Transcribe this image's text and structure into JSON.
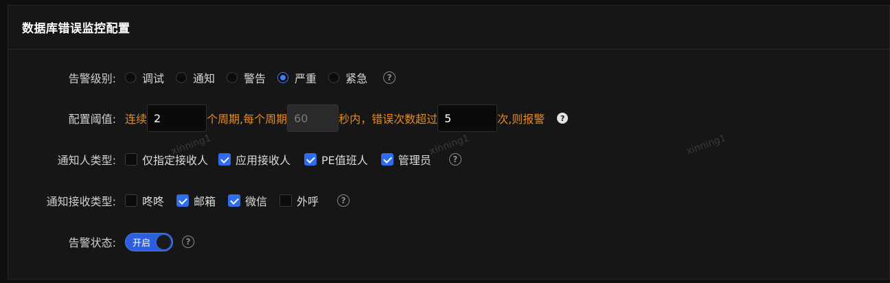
{
  "panel": {
    "title": "数据库错误监控配置"
  },
  "alert_level": {
    "label": "告警级别:",
    "options": [
      {
        "label": "调试",
        "checked": false
      },
      {
        "label": "通知",
        "checked": false
      },
      {
        "label": "警告",
        "checked": false
      },
      {
        "label": "严重",
        "checked": true
      },
      {
        "label": "紧急",
        "checked": false
      }
    ]
  },
  "threshold": {
    "label": "配置阈值:",
    "text_before_periods": "连续",
    "periods_value": "2",
    "text_after_periods": "个周期,每个周期",
    "period_seconds_placeholder": "60",
    "text_after_seconds": "秒内，错误次数超过",
    "error_count_value": "5",
    "text_after_count": "次,则报警"
  },
  "notify_person_types": {
    "label": "通知人类型:",
    "options": [
      {
        "label": "仅指定接收人",
        "checked": false
      },
      {
        "label": "应用接收人",
        "checked": true
      },
      {
        "label": "PE值班人",
        "checked": true
      },
      {
        "label": "管理员",
        "checked": true
      }
    ]
  },
  "notify_channel_types": {
    "label": "通知接收类型:",
    "options": [
      {
        "label": "咚咚",
        "checked": false
      },
      {
        "label": "邮箱",
        "checked": true
      },
      {
        "label": "微信",
        "checked": true
      },
      {
        "label": "外呼",
        "checked": false
      }
    ]
  },
  "alert_status": {
    "label": "告警状态:",
    "switch_label": "开启",
    "enabled": true
  },
  "help_glyph": "?",
  "watermark_text": "xinning1",
  "colors": {
    "accent": "#2f6cf0",
    "threshold_text": "#e88b1c",
    "background": "#161617"
  }
}
